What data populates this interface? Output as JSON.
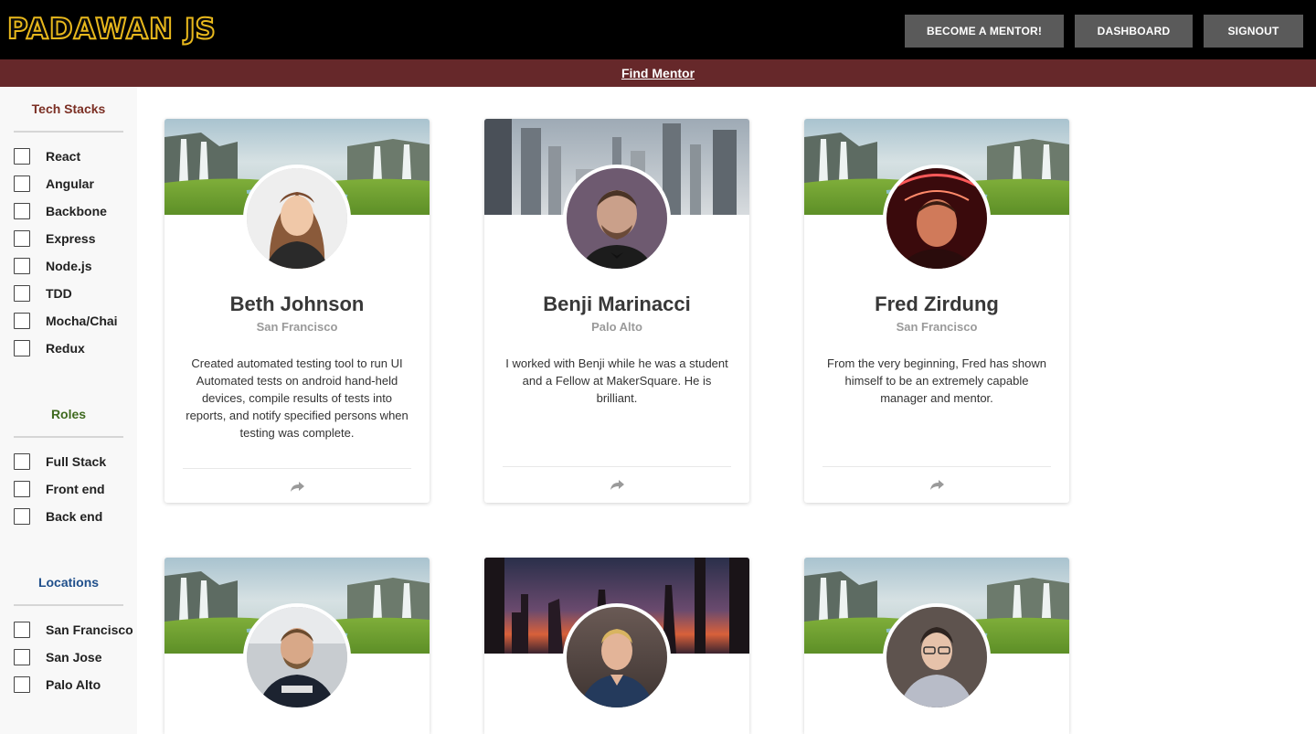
{
  "header": {
    "logo_text": "PADAWAN",
    "logo_suffix": "JS",
    "buttons": {
      "become_mentor": "BECOME A MENTOR!",
      "dashboard": "DASHBOARD",
      "signout": "SIGNOUT"
    }
  },
  "subnav": {
    "find_mentor": "Find Mentor"
  },
  "sidebar": {
    "tech_stacks": {
      "title": "Tech Stacks",
      "color": "#7b2f24",
      "items": [
        "React",
        "Angular",
        "Backbone",
        "Express",
        "Node.js",
        "TDD",
        "Mocha/Chai",
        "Redux"
      ]
    },
    "roles": {
      "title": "Roles",
      "color": "#3f6a1f",
      "items": [
        "Full Stack",
        "Front end",
        "Back end"
      ]
    },
    "locations": {
      "title": "Locations",
      "color": "#1f4f8b",
      "items": [
        "San Francisco",
        "San Jose",
        "Palo Alto"
      ]
    }
  },
  "mentors": [
    {
      "name": "Beth Johnson",
      "location": "San Francisco",
      "description": "Created automated testing tool to run UI Automated tests on android hand-held devices, compile results of tests into reports, and notify specified persons when testing was complete.",
      "banner": "waterfall-landscape",
      "share_icon": "share-arrow-icon"
    },
    {
      "name": "Benji Marinacci",
      "location": "Palo Alto",
      "description": "I worked with Benji while he was a student and a Fellow at MakerSquare. He is brilliant.",
      "banner": "futuristic-city",
      "share_icon": "share-arrow-icon"
    },
    {
      "name": "Fred Zirdung",
      "location": "San Francisco",
      "description": "From the very beginning, Fred has shown himself to be an extremely capable manager and mentor.",
      "banner": "waterfall-landscape",
      "share_icon": "share-arrow-icon"
    },
    {
      "banner": "waterfall-landscape"
    },
    {
      "banner": "city-sunset-skyline"
    },
    {
      "banner": "waterfall-landscape"
    }
  ],
  "colors": {
    "topbar": "#000000",
    "subbar": "#66282a",
    "button": "#5a5a5a",
    "logo_gold": "#e8b81c"
  }
}
